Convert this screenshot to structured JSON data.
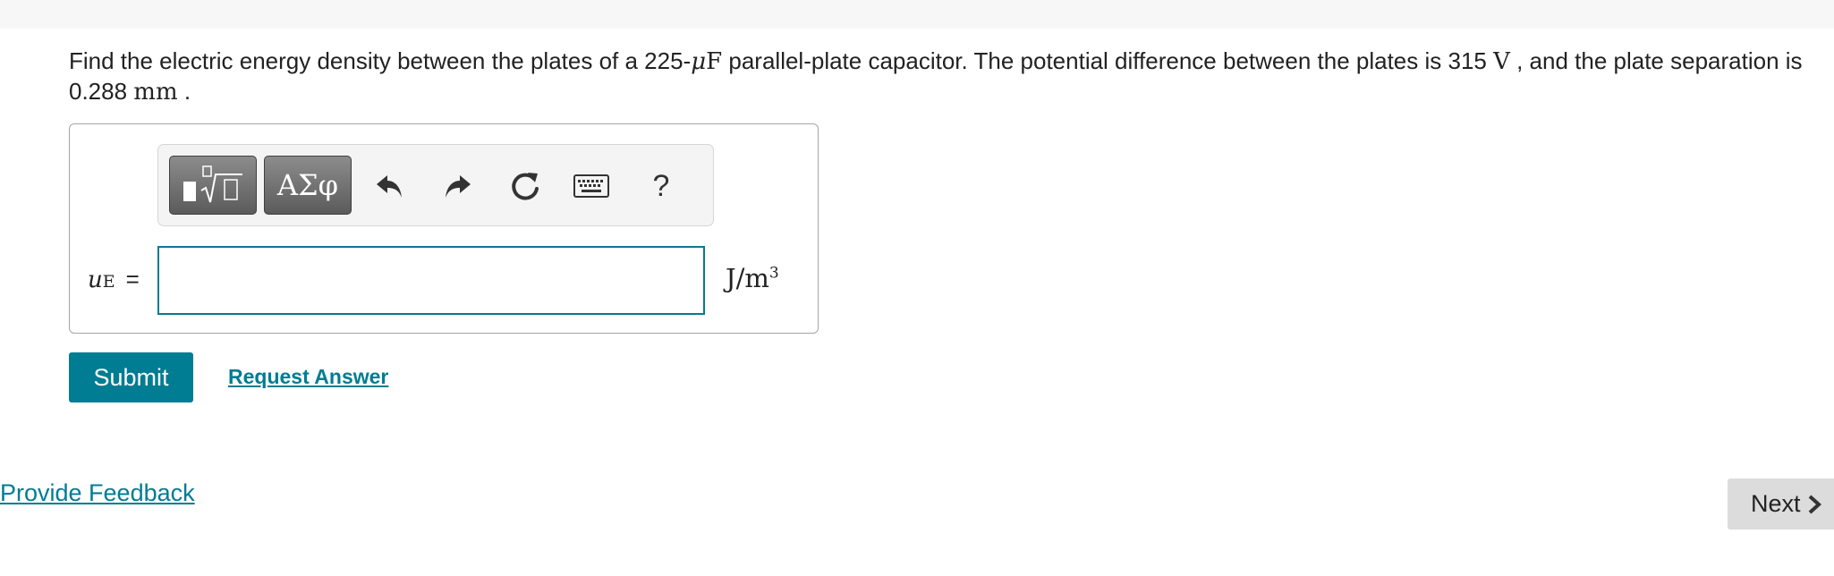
{
  "question": {
    "text_before_mu": "Find the electric energy density between the plates of a 225-",
    "mu": "μ",
    "F": "F",
    "text_mid": " parallel-plate capacitor. The potential difference between the plates is 315 ",
    "V": "V",
    "text_after_V": " , and the plate separation is",
    "separation_value": "0.288 ",
    "separation_unit": "mm",
    "end": " ."
  },
  "toolbar": {
    "symbols_label": "ΑΣφ",
    "help_label": "?",
    "templates_icon": "fraction-sqrt-template-icon",
    "undo_icon": "undo-icon",
    "redo_icon": "redo-icon",
    "reset_icon": "reset-icon",
    "keyboard_icon": "keyboard-icon"
  },
  "answer": {
    "variable": "u",
    "subscript": "E",
    "equals": "=",
    "value": "",
    "unit": "J/m",
    "unit_exp": "3"
  },
  "actions": {
    "submit_label": "Submit",
    "request_answer_label": "Request Answer"
  },
  "footer": {
    "feedback_label": "Provide Feedback",
    "next_label": "Next"
  },
  "colors": {
    "accent": "#007c93",
    "toolbar_button": "#6e6e6e",
    "next_bg": "#dcdcdc"
  }
}
